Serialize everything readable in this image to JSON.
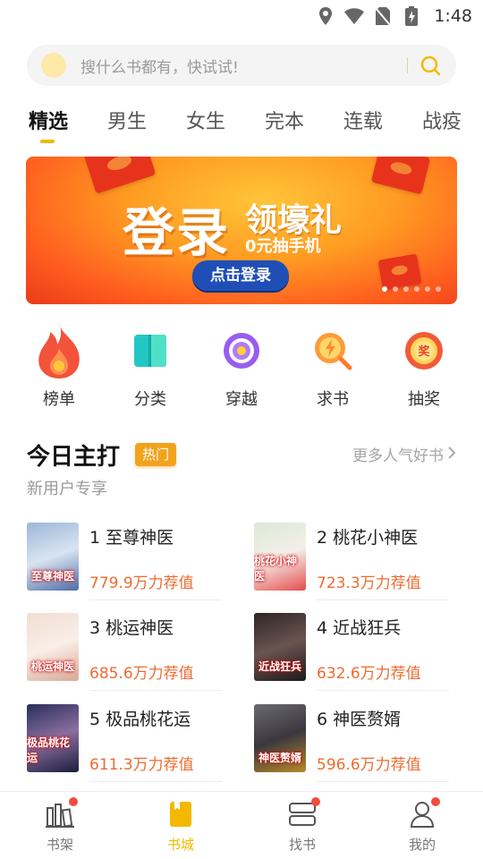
{
  "status_bar": {
    "time": "1:48",
    "icons": [
      "location-icon",
      "wifi-icon",
      "no-sim-icon",
      "battery-icon"
    ]
  },
  "search": {
    "placeholder": "搜什么书都有，快试试!"
  },
  "tabs": [
    {
      "label": "精选",
      "active": true
    },
    {
      "label": "男生"
    },
    {
      "label": "女生"
    },
    {
      "label": "完本"
    },
    {
      "label": "连载"
    },
    {
      "label": "战疫"
    }
  ],
  "banner": {
    "title": "登录",
    "gift": "领壕礼",
    "subtitle": "0元抽手机",
    "button": "点击登录",
    "slides": 6,
    "current": 0
  },
  "quick_entries": [
    {
      "label": "榜单",
      "icon": "fire-icon"
    },
    {
      "label": "分类",
      "icon": "book-category-icon"
    },
    {
      "label": "穿越",
      "icon": "portal-icon"
    },
    {
      "label": "求书",
      "icon": "search-book-icon"
    },
    {
      "label": "抽奖",
      "icon": "lottery-icon"
    }
  ],
  "section": {
    "title": "今日主打",
    "badge": "热门",
    "more": "更多人气好书",
    "subtitle": "新用户专享"
  },
  "books": [
    {
      "title": "1 至尊神医",
      "score": "779.9万力荐值",
      "cover_text": "至尊神医",
      "cover_color": "#6a8fc2"
    },
    {
      "title": "2 桃花小神医",
      "score": "723.3万力荐值",
      "cover_text": "桃花小神医",
      "cover_color": "#c7d9c0"
    },
    {
      "title": "3 桃运神医",
      "score": "685.6万力荐值",
      "cover_text": "桃运神医",
      "cover_color": "#e8c9b5"
    },
    {
      "title": "4 近战狂兵",
      "score": "632.6万力荐值",
      "cover_text": "近战狂兵",
      "cover_color": "#4a3b3a"
    },
    {
      "title": "5 极品桃花运",
      "score": "611.3万力荐值",
      "cover_text": "极品桃花运",
      "cover_color": "#3a3f6e"
    },
    {
      "title": "6 神医赘婿",
      "score": "596.6万力荐值",
      "cover_text": "神医赘婿",
      "cover_color": "#4e4c52"
    }
  ],
  "bottom_nav": [
    {
      "label": "书架",
      "icon": "bookshelf-icon",
      "dot": true
    },
    {
      "label": "书城",
      "icon": "bookstore-icon",
      "active": true,
      "dot": false
    },
    {
      "label": "找书",
      "icon": "find-book-icon",
      "dot": true
    },
    {
      "label": "我的",
      "icon": "profile-icon",
      "dot": true
    }
  ],
  "colors": {
    "accent": "#f5b800",
    "score": "#ee6b2f",
    "badge": "#f2a31d",
    "dot": "#f24b3f"
  }
}
